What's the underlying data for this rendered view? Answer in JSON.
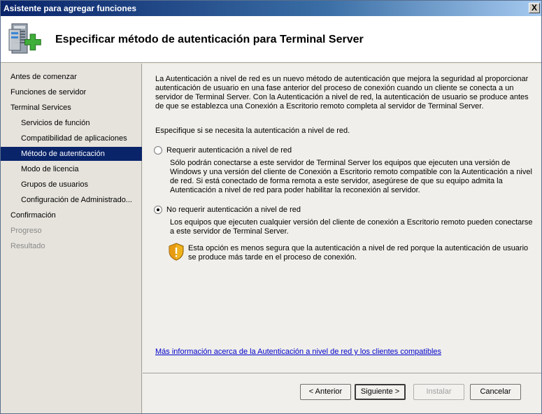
{
  "window": {
    "title": "Asistente para agregar funciones",
    "close_glyph": "X"
  },
  "header": {
    "title": "Especificar método de autenticación para Terminal Server",
    "icon": "server-add-icon"
  },
  "sidebar": {
    "items": [
      {
        "label": "Antes de comenzar"
      },
      {
        "label": "Funciones de servidor"
      },
      {
        "label": "Terminal Services"
      },
      {
        "label": "Servicios de función"
      },
      {
        "label": "Compatibilidad de aplicaciones"
      },
      {
        "label": "Método de autenticación"
      },
      {
        "label": "Modo de licencia"
      },
      {
        "label": "Grupos de usuarios"
      },
      {
        "label": "Configuración de Administrado..."
      },
      {
        "label": "Confirmación"
      },
      {
        "label": "Progreso"
      },
      {
        "label": "Resultado"
      }
    ],
    "active_index": 5
  },
  "content": {
    "intro_lines": [
      "La Autenticación a nivel de red es un nuevo método de autenticación que mejora la seguridad al proporcionar",
      "autenticación de usuario en una fase anterior del proceso de conexión cuando un cliente se conecta a un",
      "servidor de Terminal Server. Con la Autenticación a nivel de red, la autenticación de usuario se produce antes",
      "de que se establezca una Conexión a Escritorio remoto completa al servidor de Terminal Server."
    ],
    "prompt": "Especifique si se necesita la autenticación a nivel de red.",
    "option1": {
      "label": "Requerir autenticación a nivel de red",
      "checked": false,
      "desc_lines": [
        "Sólo podrán conectarse a este servidor de Terminal Server los equipos que ejecuten una versión de",
        "Windows y una versión del cliente de Conexión a Escritorio remoto compatible con la Autenticación a nivel",
        "de red. Si está conectado de forma remota a este servidor, asegúrese de que su equipo admita la",
        "Autenticación a nivel de red para poder habilitar la reconexión al servidor."
      ]
    },
    "option2": {
      "label": "No requerir autenticación a nivel de red",
      "checked": true,
      "desc_lines": [
        "Los equipos que ejecuten cualquier versión del cliente de conexión a Escritorio remoto pueden conectarse",
        "a este servidor de Terminal Server."
      ]
    },
    "warning": {
      "icon": "security-shield-warning-icon",
      "lines": [
        "Esta opción es menos segura que la autenticación a nivel de red porque la autenticación de usuario",
        "se produce más tarde en el proceso de conexión."
      ]
    },
    "link": "Más información acerca de la Autenticación a nivel de red y los clientes compatibles"
  },
  "buttons": {
    "back": "< Anterior",
    "next": "Siguiente >",
    "install": "Instalar",
    "cancel": "Cancelar"
  },
  "colors": {
    "titlebar": "#0a246a",
    "selection": "#0a246a",
    "link": "#0000cc"
  }
}
